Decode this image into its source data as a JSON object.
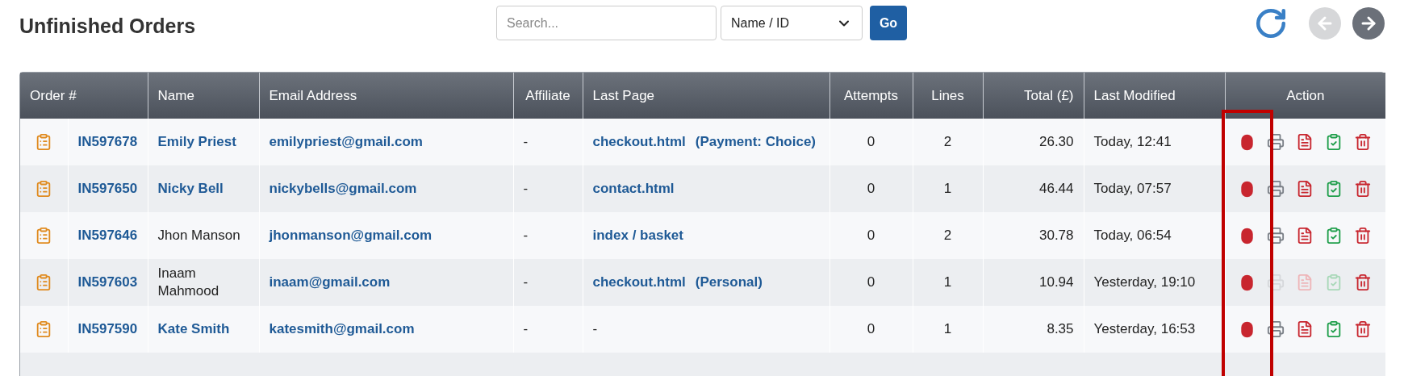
{
  "page": {
    "title": "Unfinished Orders"
  },
  "search": {
    "placeholder": "Search...",
    "filter": "Name / ID",
    "go": "Go"
  },
  "nav": {
    "back_disabled": true,
    "forward_disabled": false
  },
  "table": {
    "columns": [
      "Order #",
      "Name",
      "Email Address",
      "Affiliate",
      "Last Page",
      "Attempts",
      "Lines",
      "Total (£)",
      "Last Modified",
      "Action"
    ],
    "rows": [
      {
        "order": "IN597678",
        "name": "Emily Priest",
        "name_linked": true,
        "email": "emilypriest@gmail.com",
        "affiliate": "-",
        "last_page": "checkout.html",
        "last_page_linked": true,
        "last_page_note": "(Payment: Choice)",
        "attempts": "0",
        "lines": "2",
        "total": "26.30",
        "modified": "Today, 12:41",
        "documents_disabled": false
      },
      {
        "order": "IN597650",
        "name": "Nicky Bell",
        "name_linked": true,
        "email": "nickybells@gmail.com",
        "affiliate": "-",
        "last_page": "contact.html",
        "last_page_linked": true,
        "attempts": "0",
        "lines": "1",
        "total": "46.44",
        "modified": "Today, 07:57",
        "documents_disabled": false
      },
      {
        "order": "IN597646",
        "name": "Jhon Manson",
        "name_linked": false,
        "email": "jhonmanson@gmail.com",
        "affiliate": "-",
        "last_page": "index / basket",
        "last_page_linked": true,
        "attempts": "0",
        "lines": "2",
        "total": "30.78",
        "modified": "Today, 06:54",
        "documents_disabled": false
      },
      {
        "order": "IN597603",
        "name": "Inaam Mahmood",
        "name_linked": false,
        "email": "inaam@gmail.com",
        "affiliate": "-",
        "last_page": "checkout.html",
        "last_page_linked": true,
        "last_page_note": "(Personal)",
        "attempts": "0",
        "lines": "1",
        "total": "10.94",
        "modified": "Yesterday, 19:10",
        "documents_disabled": true
      },
      {
        "order": "IN597590",
        "name": "Kate Smith",
        "name_linked": true,
        "email": "katesmith@gmail.com",
        "affiliate": "-",
        "last_page": "-",
        "last_page_linked": false,
        "attempts": "0",
        "lines": "1",
        "total": "8.35",
        "modified": "Yesterday, 16:53",
        "documents_disabled": false
      }
    ]
  }
}
